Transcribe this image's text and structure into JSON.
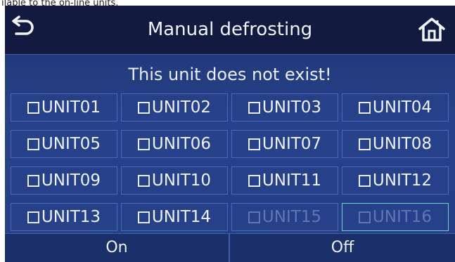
{
  "caption": "ilable to the on-line units.",
  "header": {
    "title": "Manual defrosting",
    "back_icon": "back-arrow-icon",
    "home_icon": "home-icon"
  },
  "message": "This unit does not exist!",
  "units": [
    {
      "label": "UNIT01",
      "state": "normal"
    },
    {
      "label": "UNIT02",
      "state": "normal"
    },
    {
      "label": "UNIT03",
      "state": "normal"
    },
    {
      "label": "UNIT04",
      "state": "normal"
    },
    {
      "label": "UNIT05",
      "state": "normal"
    },
    {
      "label": "UNIT06",
      "state": "normal"
    },
    {
      "label": "UNIT07",
      "state": "normal"
    },
    {
      "label": "UNIT08",
      "state": "normal"
    },
    {
      "label": "UNIT09",
      "state": "normal"
    },
    {
      "label": "UNIT10",
      "state": "normal"
    },
    {
      "label": "UNIT11",
      "state": "normal"
    },
    {
      "label": "UNIT12",
      "state": "normal"
    },
    {
      "label": "UNIT13",
      "state": "normal"
    },
    {
      "label": "UNIT14",
      "state": "normal"
    },
    {
      "label": "UNIT15",
      "state": "disabled"
    },
    {
      "label": "UNIT16",
      "state": "disabled-selected"
    }
  ],
  "footer": {
    "on_label": "On",
    "off_label": "Off"
  },
  "colors": {
    "header_bg": "#121b3f",
    "panel_bg": "#243e80",
    "text": "#eef2ff",
    "disabled_text": "#5f77b4",
    "focus_border": "#6fd0c8"
  }
}
